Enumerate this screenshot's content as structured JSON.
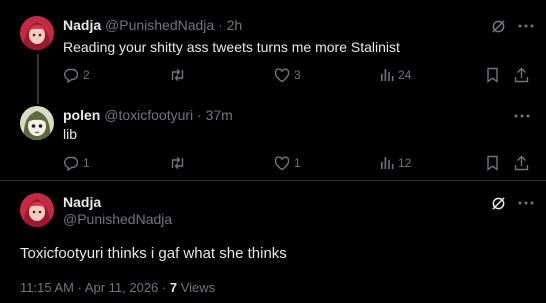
{
  "tweets": [
    {
      "display_name": "Nadja",
      "handle": "@PunishedNadja",
      "separator": "·",
      "time": "2h",
      "text": "Reading your shitty ass tweets turns me more Stalinist",
      "replies": "2",
      "reposts": "",
      "likes": "3",
      "views": "24",
      "avatar": "red-haired-anime-avatar"
    },
    {
      "display_name": "polen",
      "handle": "@toxicfootyuri",
      "separator": "·",
      "time": "37m",
      "text": "lib",
      "replies": "1",
      "reposts": "",
      "likes": "1",
      "views": "12",
      "avatar": "green-cartoon-avatar"
    }
  ],
  "focus": {
    "display_name": "Nadja",
    "handle": "@PunishedNadja",
    "text": "Toxicfootyuri thinks i gaf what she thinks",
    "timestamp": "11:15 AM · Apr 11, 2026",
    "separator": "·",
    "views_count": "7",
    "views_label": "Views",
    "avatar": "red-haired-anime-avatar"
  },
  "colors": {
    "background": "#000000",
    "text_primary": "#e7e9ea",
    "text_muted": "#71767b",
    "divider": "#2f3336"
  }
}
